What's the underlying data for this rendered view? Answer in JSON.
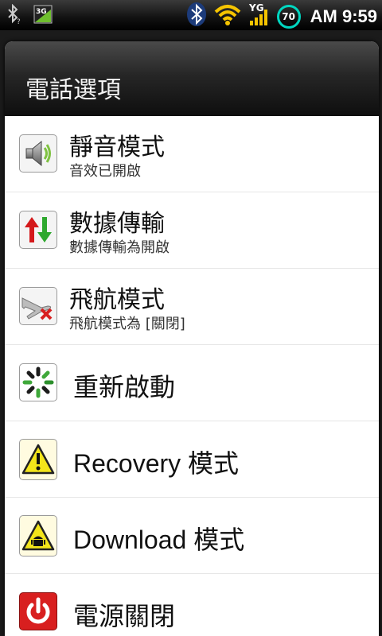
{
  "status_bar": {
    "icons": [
      "bluetooth-search-icon",
      "3g-icon",
      "bluetooth-icon",
      "wifi-icon",
      "signal-icon"
    ],
    "network_label": "3G",
    "battery_level": "70",
    "time": "AM 9:59"
  },
  "dialog": {
    "title": "電話選項",
    "items": [
      {
        "title": "靜音模式",
        "subtitle": "音效已開啟",
        "icon": "speaker-icon"
      },
      {
        "title": "數據傳輸",
        "subtitle": "數據傳輸為開啟",
        "icon": "data-transfer-icon"
      },
      {
        "title": "飛航模式",
        "subtitle": "飛航模式為 [關閉]",
        "icon": "airplane-icon"
      },
      {
        "title": "重新啟動",
        "icon": "restart-icon"
      },
      {
        "title": "Recovery 模式",
        "icon": "warning-icon"
      },
      {
        "title": "Download 模式",
        "icon": "android-warning-icon"
      },
      {
        "title": "電源關閉",
        "icon": "power-icon"
      }
    ]
  },
  "colors": {
    "battery_ring": "#00d6c0",
    "data_up": "#d4191b",
    "data_down": "#2ea82e",
    "warning": "#f3e51a",
    "power": "#d81f1f"
  }
}
